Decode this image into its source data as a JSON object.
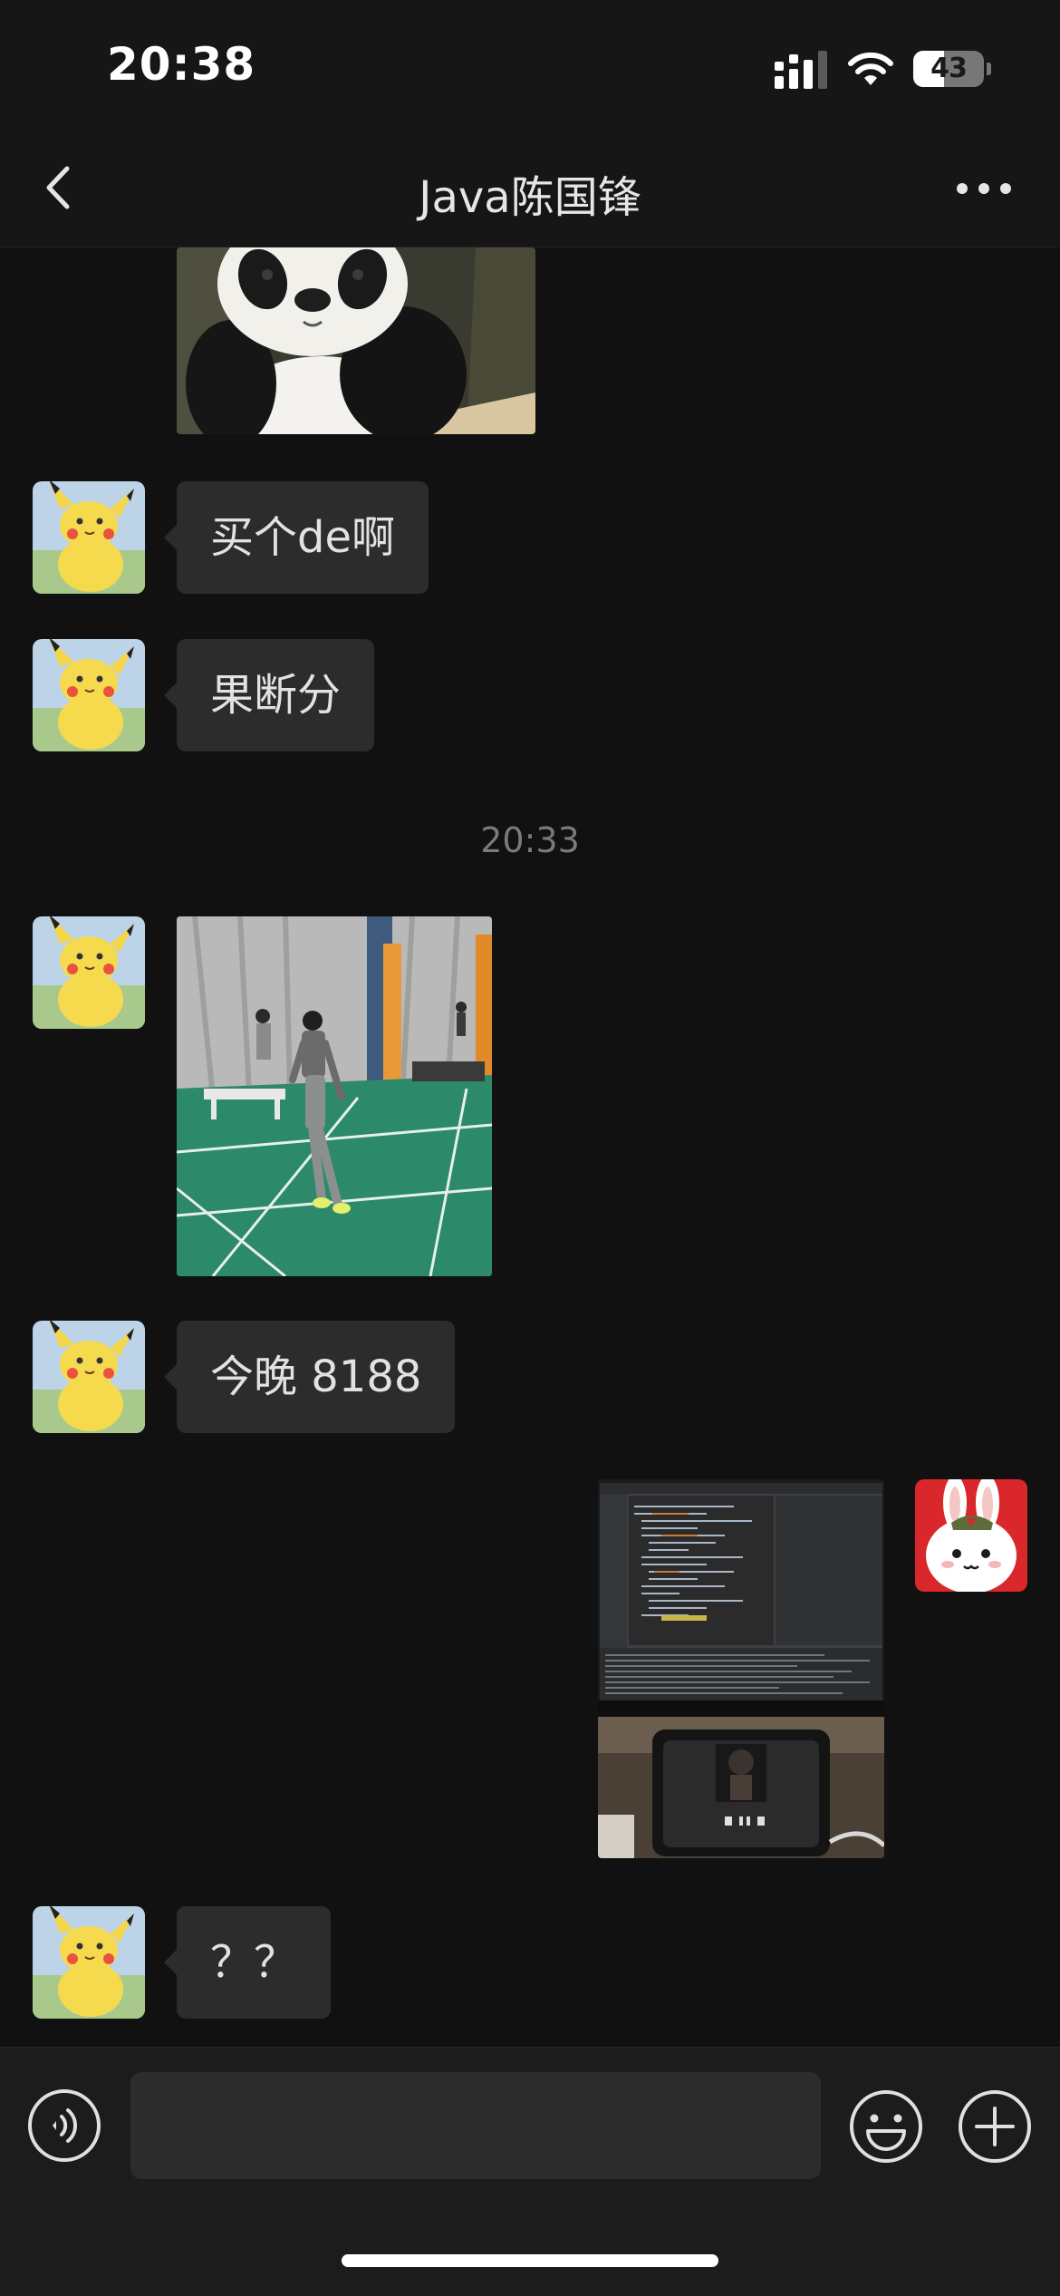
{
  "status_bar": {
    "time": "20:38",
    "battery": "43",
    "battery_level": 0.43
  },
  "header": {
    "title": "Java陈国锋"
  },
  "messages": [
    {
      "kind": "image",
      "side": "left",
      "image": "panda-photo"
    },
    {
      "kind": "text",
      "side": "left",
      "text": "买个de啊"
    },
    {
      "kind": "text",
      "side": "left",
      "text": "果断分"
    },
    {
      "kind": "timestamp",
      "text": "20:33"
    },
    {
      "kind": "image",
      "side": "left",
      "image": "badminton-court-photo"
    },
    {
      "kind": "text",
      "side": "left",
      "text": "今晚 8188"
    },
    {
      "kind": "image",
      "side": "right",
      "image": "computer-monitor-photo"
    },
    {
      "kind": "text",
      "side": "left",
      "text": "？？"
    }
  ],
  "input": {
    "placeholder": "",
    "value": ""
  },
  "icons": {
    "back": "chevron-left-icon",
    "more": "more-icon",
    "voice": "voice-icon",
    "emoji": "emoji-icon",
    "plus": "plus-icon"
  },
  "colors": {
    "background": "#111111",
    "bar": "#161616",
    "bubble": "#2c2c2c",
    "text": "#e2e2e2",
    "timestamp": "#7a7a7a"
  }
}
